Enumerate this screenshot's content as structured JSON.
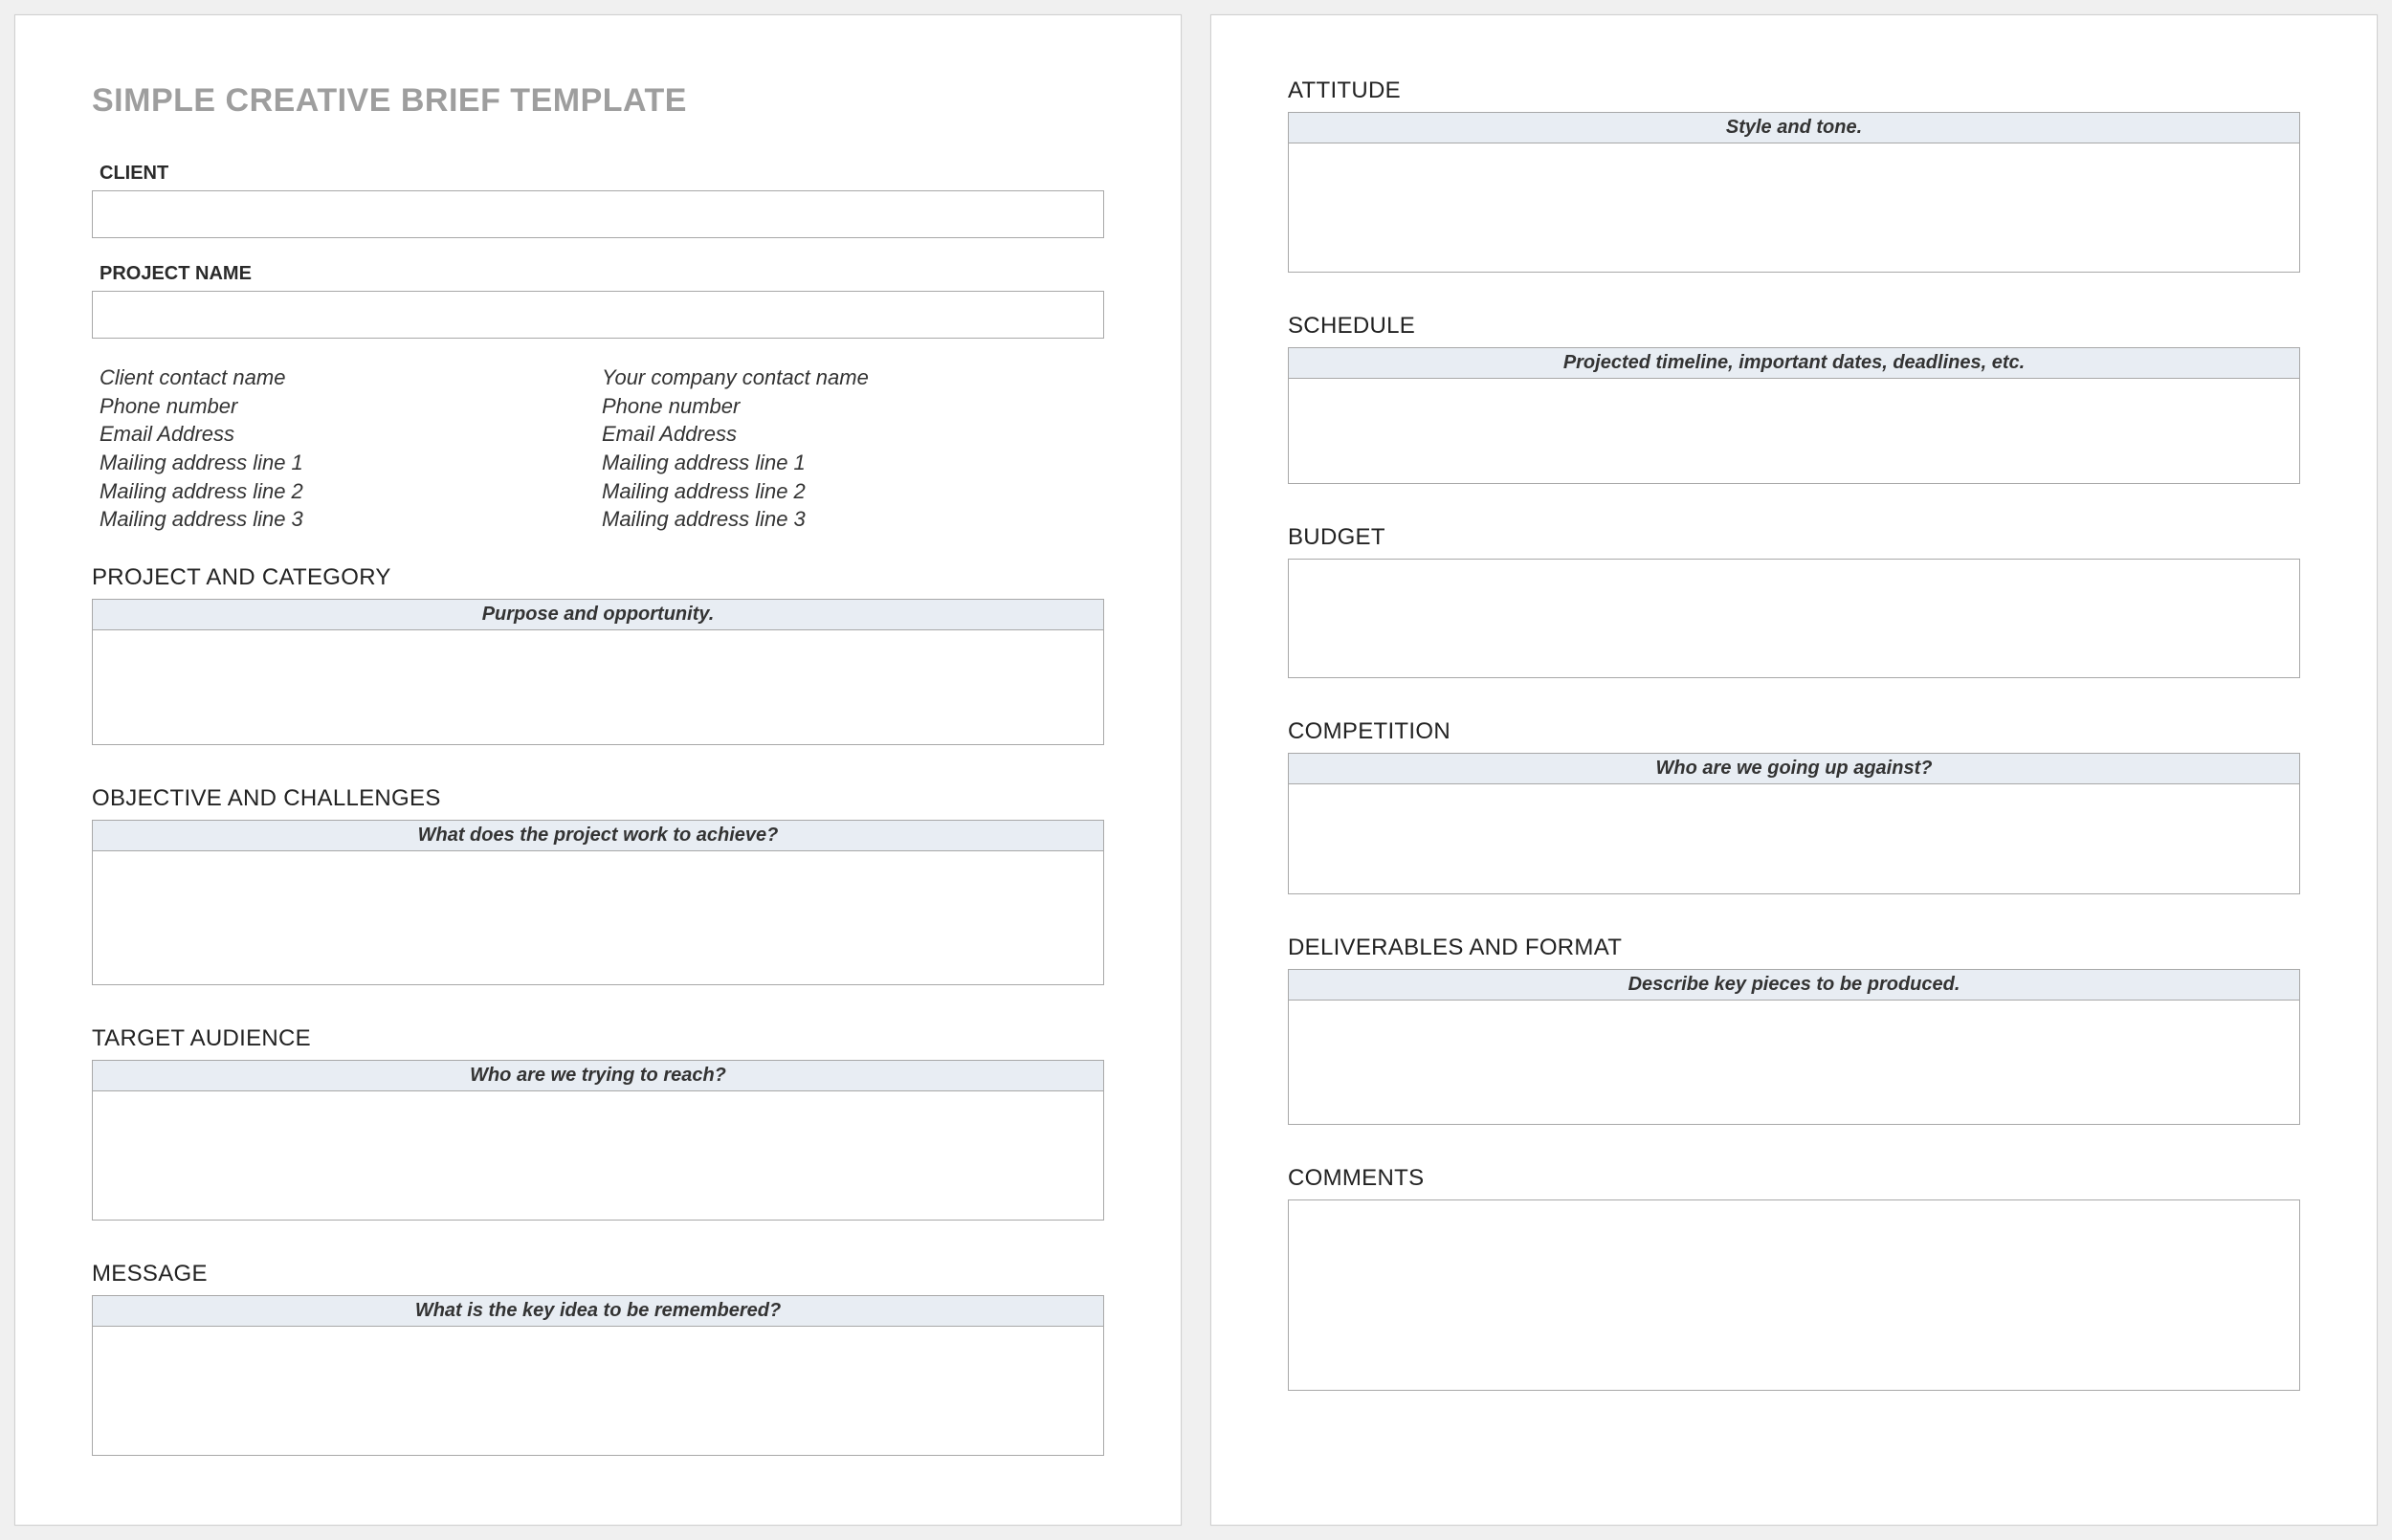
{
  "title": "SIMPLE CREATIVE BRIEF TEMPLATE",
  "fields": {
    "client_label": "CLIENT",
    "project_name_label": "PROJECT NAME"
  },
  "client_contact": [
    "Client contact name",
    "Phone number",
    "Email Address",
    "Mailing address line 1",
    "Mailing address line 2",
    "Mailing address line 3"
  ],
  "company_contact": [
    "Your company contact name",
    "Phone number",
    "Email Address",
    "Mailing address line 1",
    "Mailing address line 2",
    "Mailing address line 3"
  ],
  "sections": {
    "project_category": {
      "heading": "PROJECT AND CATEGORY",
      "hint": "Purpose and opportunity."
    },
    "objective": {
      "heading": "OBJECTIVE AND CHALLENGES",
      "hint": "What does the project work to achieve?"
    },
    "audience": {
      "heading": "TARGET AUDIENCE",
      "hint": "Who are we trying to reach?"
    },
    "message": {
      "heading": "MESSAGE",
      "hint": "What is the key idea to be remembered?"
    },
    "attitude": {
      "heading": "ATTITUDE",
      "hint": "Style and tone."
    },
    "schedule": {
      "heading": "SCHEDULE",
      "hint": "Projected timeline, important dates, deadlines, etc."
    },
    "budget": {
      "heading": "BUDGET"
    },
    "competition": {
      "heading": "COMPETITION",
      "hint": "Who are we going up against?"
    },
    "deliverables": {
      "heading": "DELIVERABLES AND FORMAT",
      "hint": "Describe key pieces to be produced."
    },
    "comments": {
      "heading": "COMMENTS"
    }
  }
}
